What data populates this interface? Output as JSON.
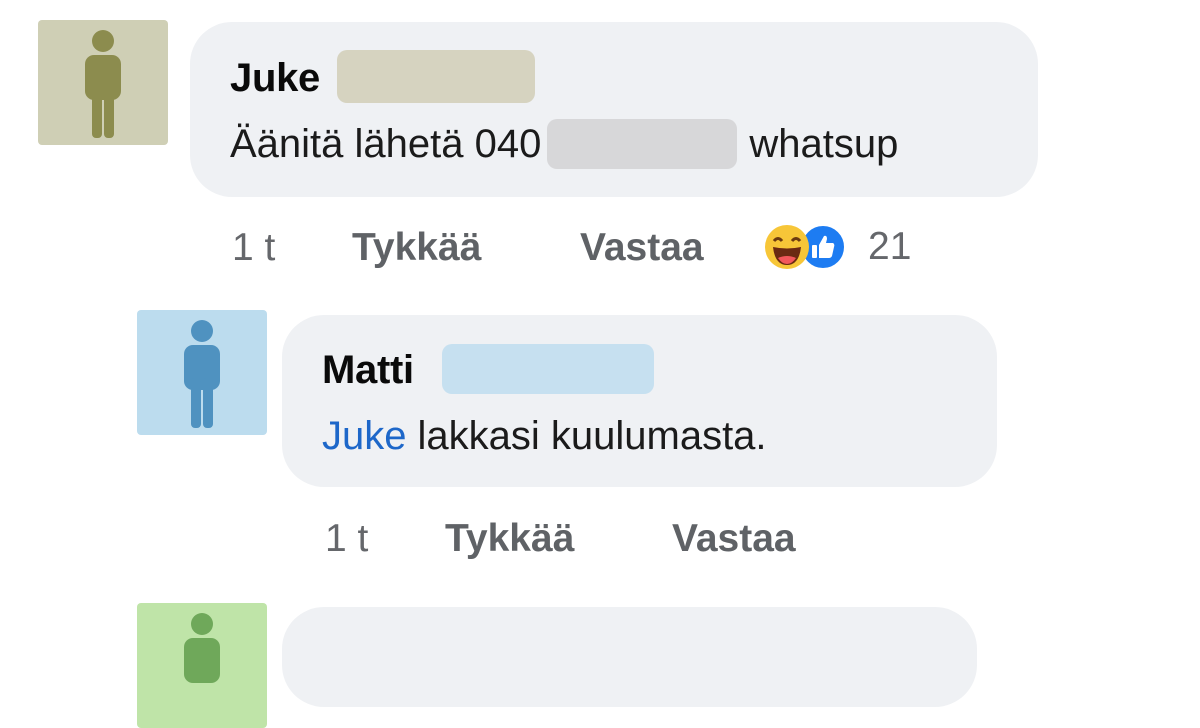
{
  "colors": {
    "avatar1_bg": "#cfcfb5",
    "avatar1_figure": "#8c8c4e",
    "avatar2_bg": "#bcdcee",
    "avatar2_figure": "#4f92c0",
    "avatar3_bg": "#bfe4a8",
    "avatar3_figure": "#6fa85a",
    "bubble": "#eff1f4",
    "mention": "#1d67c9",
    "meta": "#65676b"
  },
  "comment1": {
    "author": "Juke",
    "text_before": "Äänitä lähetä 040",
    "text_after": "whatsup",
    "time": "1 t",
    "like": "Tykkää",
    "reply": "Vastaa",
    "reaction_icons": [
      "laughing-emoji-icon",
      "thumbs-up-icon"
    ],
    "reaction_count": "21"
  },
  "comment2": {
    "author": "Matti",
    "mention": "Juke",
    "text": "lakkasi kuulumasta.",
    "time": "1 t",
    "like": "Tykkää",
    "reply": "Vastaa"
  }
}
